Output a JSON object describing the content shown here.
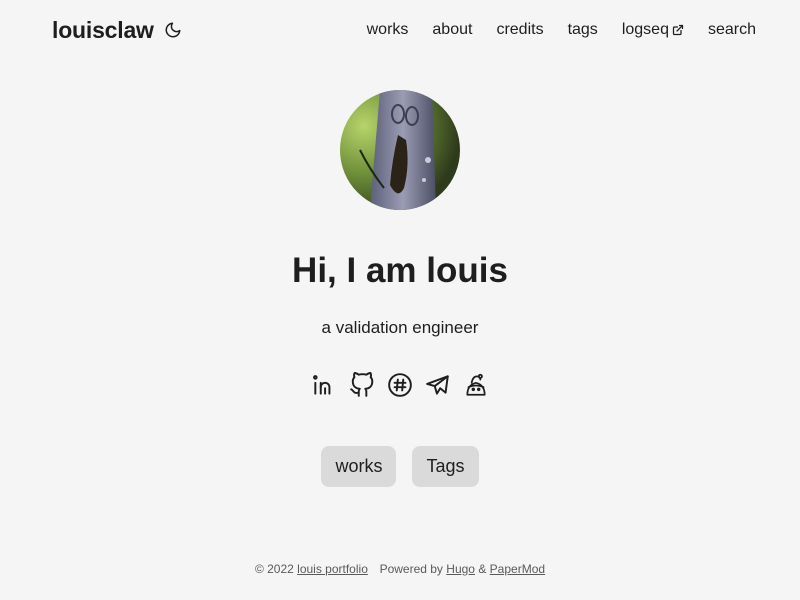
{
  "header": {
    "logo": "louisclaw",
    "theme_toggle_icon": "moon-icon",
    "nav": [
      {
        "label": "works"
      },
      {
        "label": "about"
      },
      {
        "label": "credits"
      },
      {
        "label": "tags"
      },
      {
        "label": "logseq",
        "icon": "external-link-icon"
      },
      {
        "label": "search"
      }
    ]
  },
  "profile": {
    "avatar_alt": "owl on tree branch",
    "title": "Hi, I am louis",
    "subtitle": "a validation engineer",
    "social_icons": [
      "linkedin-icon",
      "github-icon",
      "slack-icon",
      "telegram-icon",
      "custom-icon"
    ]
  },
  "buttons": [
    {
      "label": "works"
    },
    {
      "label": "Tags"
    }
  ],
  "footer": {
    "copyright": "© 2022",
    "site_link": "louis portfolio",
    "powered_by": "Powered by",
    "hugo_link": "Hugo",
    "amp": "&",
    "papermod_link": "PaperMod"
  }
}
